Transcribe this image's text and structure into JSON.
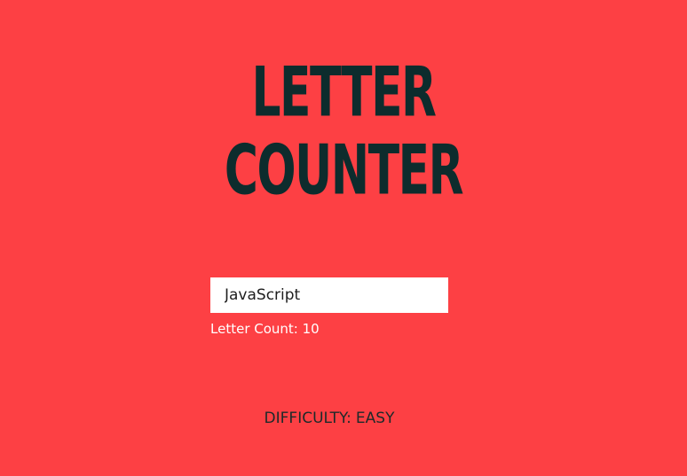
{
  "app": {
    "title_line_1": "LETTER",
    "title_line_2": "COUNTER"
  },
  "input": {
    "value": "JavaScript"
  },
  "result": {
    "label": "Letter Count:",
    "count": "10"
  },
  "footer": {
    "difficulty_label": "DIFFICULTY:",
    "difficulty_value": "EASY"
  },
  "colors": {
    "background": "#fd4044",
    "title": "#0d2c2d",
    "input_background": "#ffffff",
    "count_text": "#ffffff",
    "difficulty_text": "#1c2a2a"
  }
}
